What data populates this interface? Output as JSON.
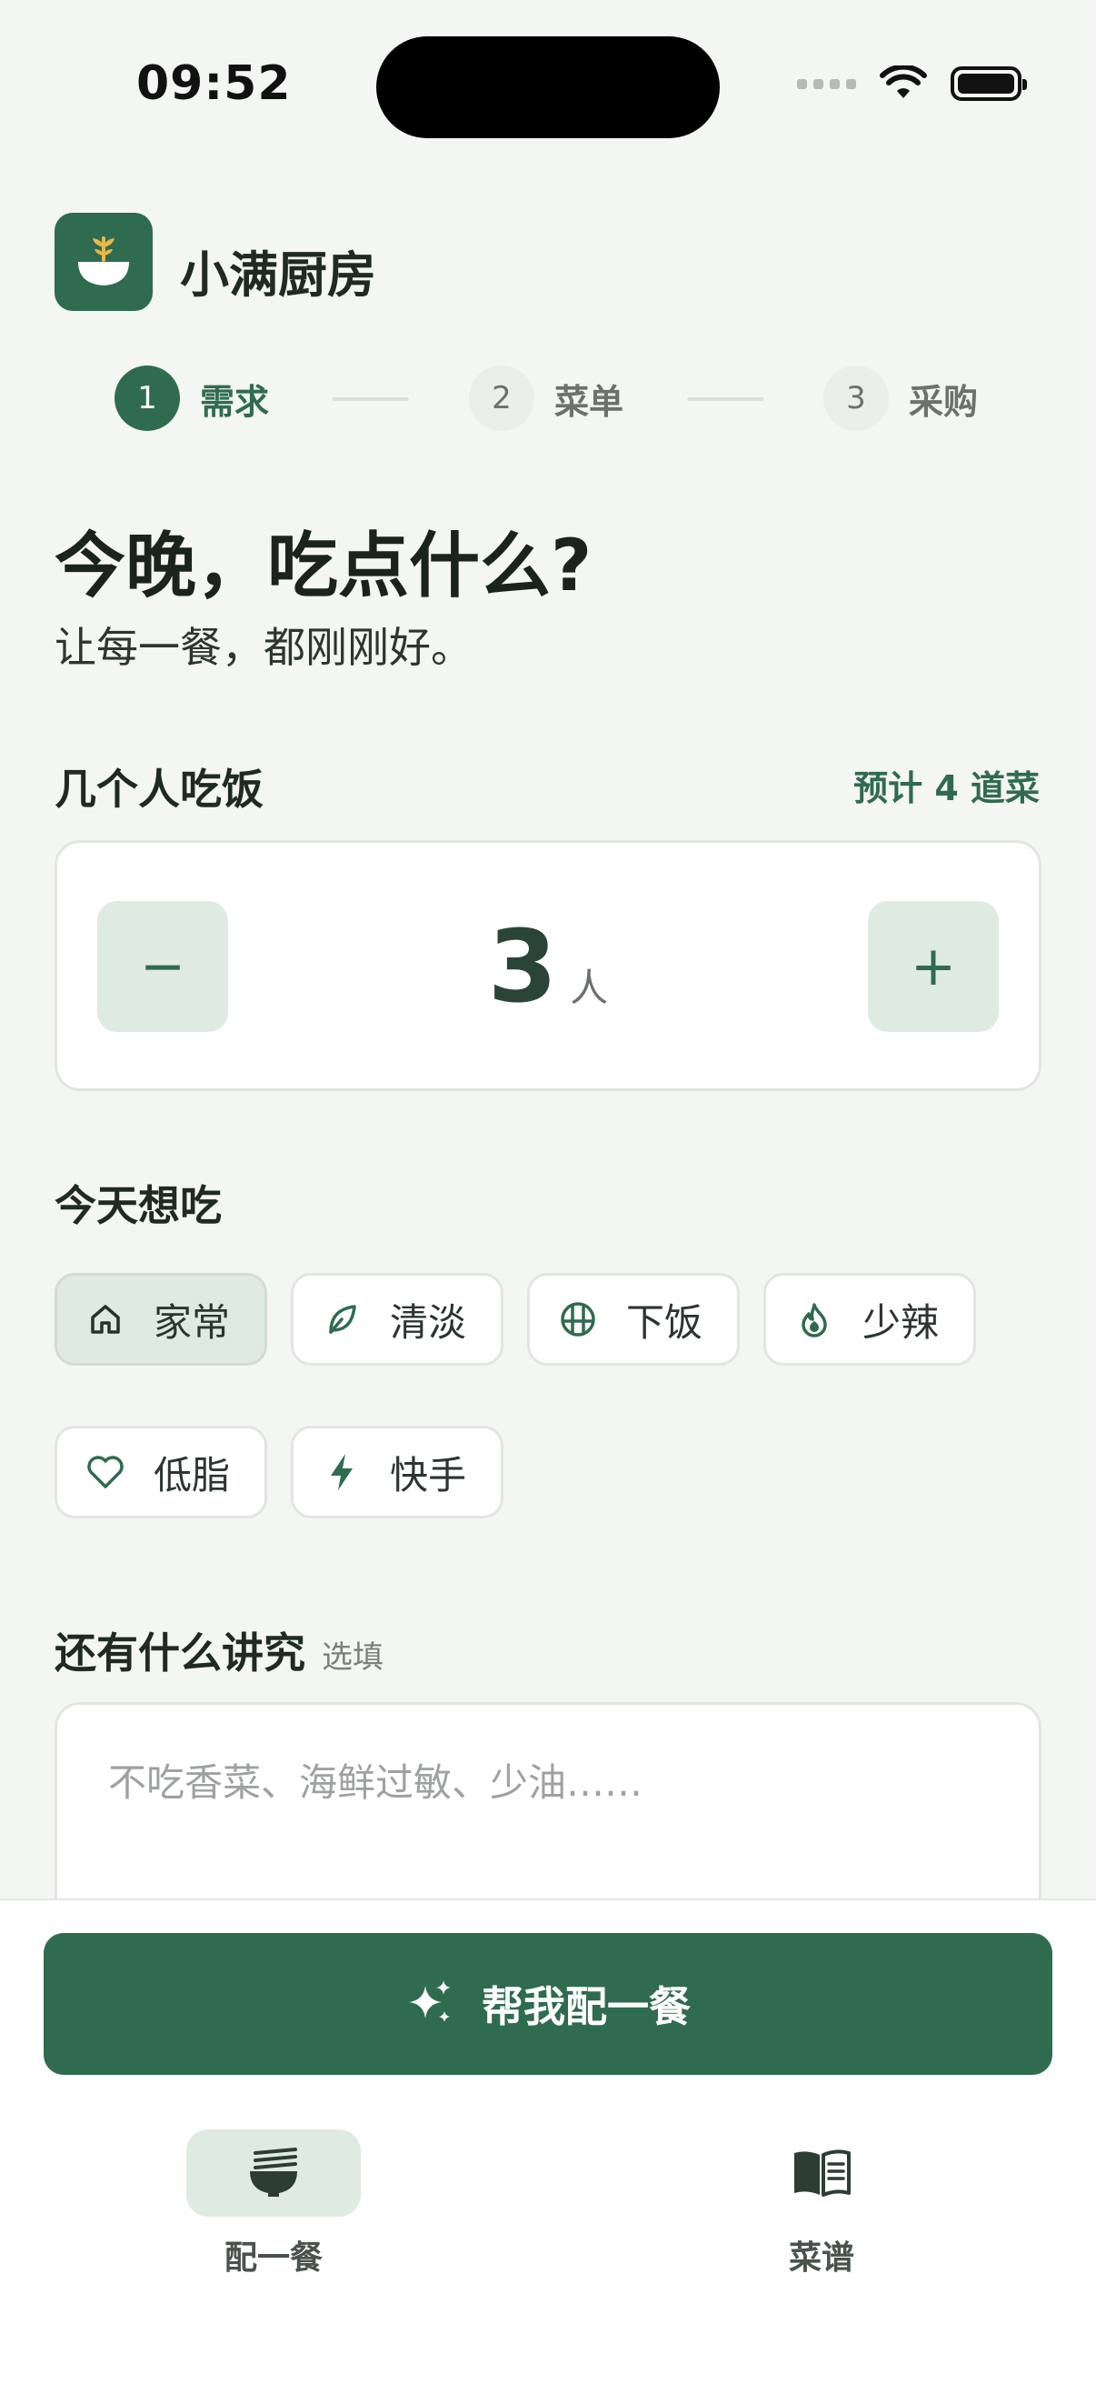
{
  "status_bar": {
    "time": "09:52"
  },
  "app": {
    "title": "小满厨房"
  },
  "stepper": {
    "steps": [
      {
        "num": "1",
        "label": "需求"
      },
      {
        "num": "2",
        "label": "菜单"
      },
      {
        "num": "3",
        "label": "采购"
      }
    ],
    "active_index": 0
  },
  "hero": {
    "title": "今晚，吃点什么?",
    "subtitle": "让每一餐，都刚刚好。"
  },
  "people": {
    "section_title": "几个人吃饭",
    "estimate": "预计 4 道菜",
    "count": "3",
    "unit": "人",
    "minus_label": "−",
    "plus_label": "+"
  },
  "preferences": {
    "section_title": "今天想吃",
    "chips": [
      {
        "label": "家常",
        "icon": "home-icon",
        "selected": true
      },
      {
        "label": "清淡",
        "icon": "leaf-icon",
        "selected": false
      },
      {
        "label": "下饭",
        "icon": "rice-bowl-icon",
        "selected": false
      },
      {
        "label": "少辣",
        "icon": "flame-icon",
        "selected": false
      },
      {
        "label": "低脂",
        "icon": "heart-icon",
        "selected": false
      },
      {
        "label": "快手",
        "icon": "bolt-icon",
        "selected": false
      }
    ]
  },
  "notes": {
    "section_title": "还有什么讲究",
    "optional_tag": "选填",
    "placeholder": "不吃香菜、海鲜过敏、少油……"
  },
  "cta": {
    "label": "帮我配一餐",
    "icon": "sparkles-icon"
  },
  "tabbar": {
    "tabs": [
      {
        "label": "配一餐",
        "icon": "noodle-bowl-icon",
        "active": true
      },
      {
        "label": "菜谱",
        "icon": "recipe-book-icon",
        "active": false
      }
    ]
  },
  "colors": {
    "brand": "#2f6b4f",
    "brand_light": "#dfeae2",
    "background": "#f4f6f3"
  }
}
